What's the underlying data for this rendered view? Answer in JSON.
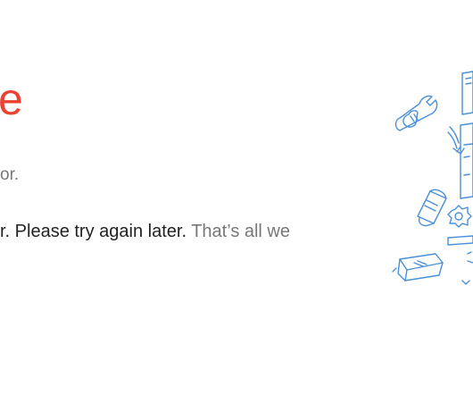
{
  "colors": {
    "brand_red": "#ea4335",
    "text_dark": "#222222",
    "text_muted": "#777777",
    "illustration_blue": "#4a90d9"
  },
  "error_page": {
    "logo_fragment": "e",
    "status_line": "or.",
    "message_primary": "r. Please try again later.",
    "message_secondary": " That’s all we"
  },
  "illustration": {
    "icon": "broken-robot-illustration"
  }
}
